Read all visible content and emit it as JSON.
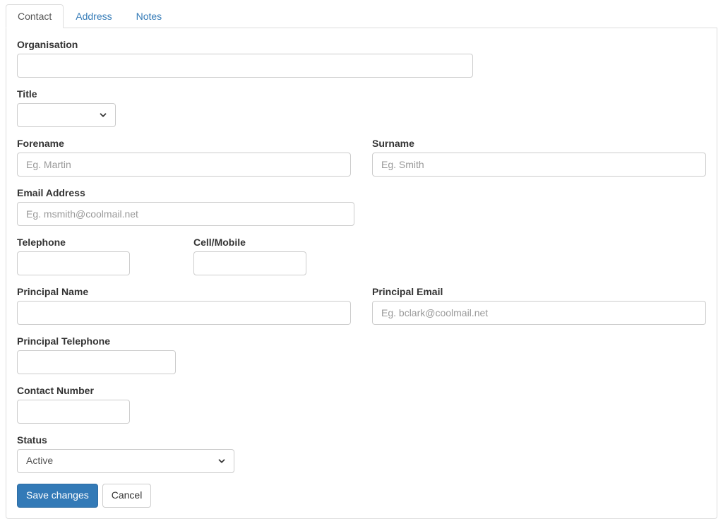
{
  "tabs": {
    "contact": "Contact",
    "address": "Address",
    "notes": "Notes"
  },
  "form": {
    "organisation": {
      "label": "Organisation",
      "value": "",
      "placeholder": ""
    },
    "title": {
      "label": "Title",
      "value": ""
    },
    "forename": {
      "label": "Forename",
      "value": "",
      "placeholder": "Eg. Martin"
    },
    "surname": {
      "label": "Surname",
      "value": "",
      "placeholder": "Eg. Smith"
    },
    "email": {
      "label": "Email Address",
      "value": "",
      "placeholder": "Eg. msmith@coolmail.net"
    },
    "telephone": {
      "label": "Telephone",
      "value": "",
      "placeholder": ""
    },
    "cellmobile": {
      "label": "Cell/Mobile",
      "value": "",
      "placeholder": ""
    },
    "principal_name": {
      "label": "Principal Name",
      "value": "",
      "placeholder": ""
    },
    "principal_email": {
      "label": "Principal Email",
      "value": "",
      "placeholder": "Eg. bclark@coolmail.net"
    },
    "principal_telephone": {
      "label": "Principal Telephone",
      "value": "",
      "placeholder": ""
    },
    "contact_number": {
      "label": "Contact Number",
      "value": "",
      "placeholder": ""
    },
    "status": {
      "label": "Status",
      "value": "Active"
    }
  },
  "buttons": {
    "save": "Save changes",
    "cancel": "Cancel"
  }
}
